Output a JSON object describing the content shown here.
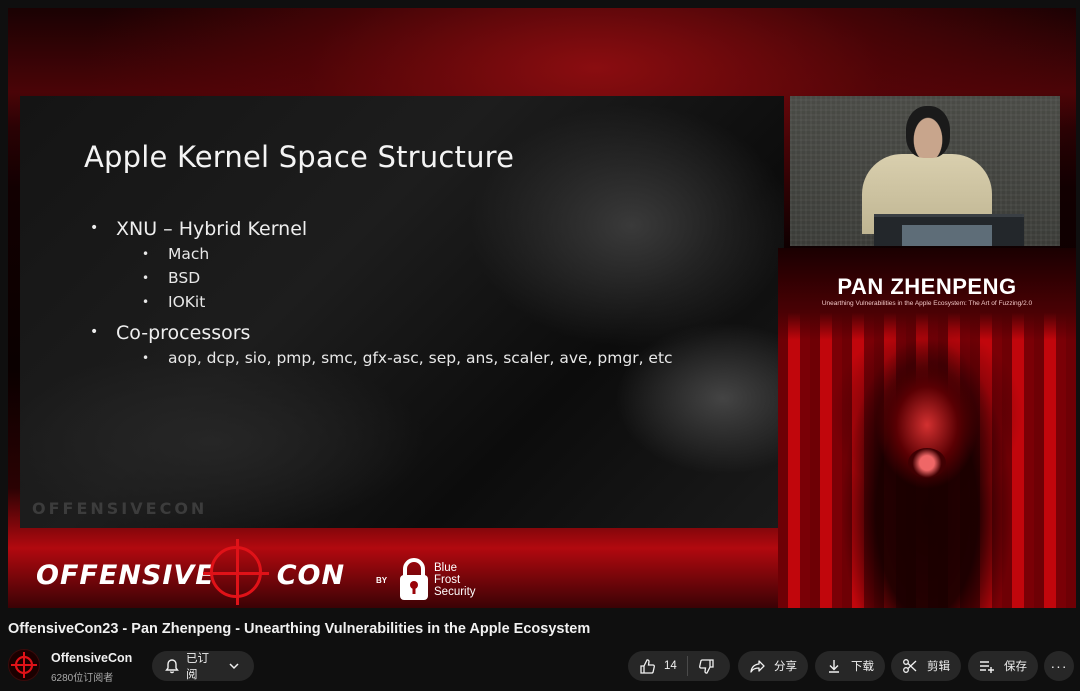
{
  "video": {
    "slide": {
      "title": "Apple Kernel Space Structure",
      "bullets": [
        {
          "label": "XNU – Hybrid Kernel",
          "sub": [
            "Mach",
            "BSD",
            "IOKit"
          ]
        },
        {
          "label": "Co-processors",
          "sub": [
            "aop, dcp, sio, pmp, smc, gfx-asc, sep, ans, scaler, ave, pmgr, etc"
          ]
        }
      ],
      "watermark": "OFFENSIVECON"
    },
    "poster": {
      "name": "PAN ZHENPENG",
      "subtitle": "Unearthing Vulnerabilities in the Apple Ecosystem: The Art of Fuzzing/2.0"
    },
    "banner": {
      "logo_left": "OFFENSIVE",
      "logo_right": "CON",
      "by": "BY",
      "sponsor_lines": [
        "Blue",
        "Frost",
        "Security"
      ]
    }
  },
  "title": "OffensiveCon23 - Pan Zhenpeng - Unearthing Vulnerabilities in the Apple Ecosystem",
  "channel": {
    "name": "OffensiveCon",
    "subscribers": "6280位订阅者"
  },
  "actions": {
    "subscribe_label": "已订阅",
    "like_count": "14",
    "share_label": "分享",
    "download_label": "下载",
    "clip_label": "剪辑",
    "save_label": "保存",
    "more_label": "···"
  },
  "colors": {
    "page_bg": "#0f0f0f",
    "pill_bg": "#272727",
    "brand_red": "#e01218"
  }
}
